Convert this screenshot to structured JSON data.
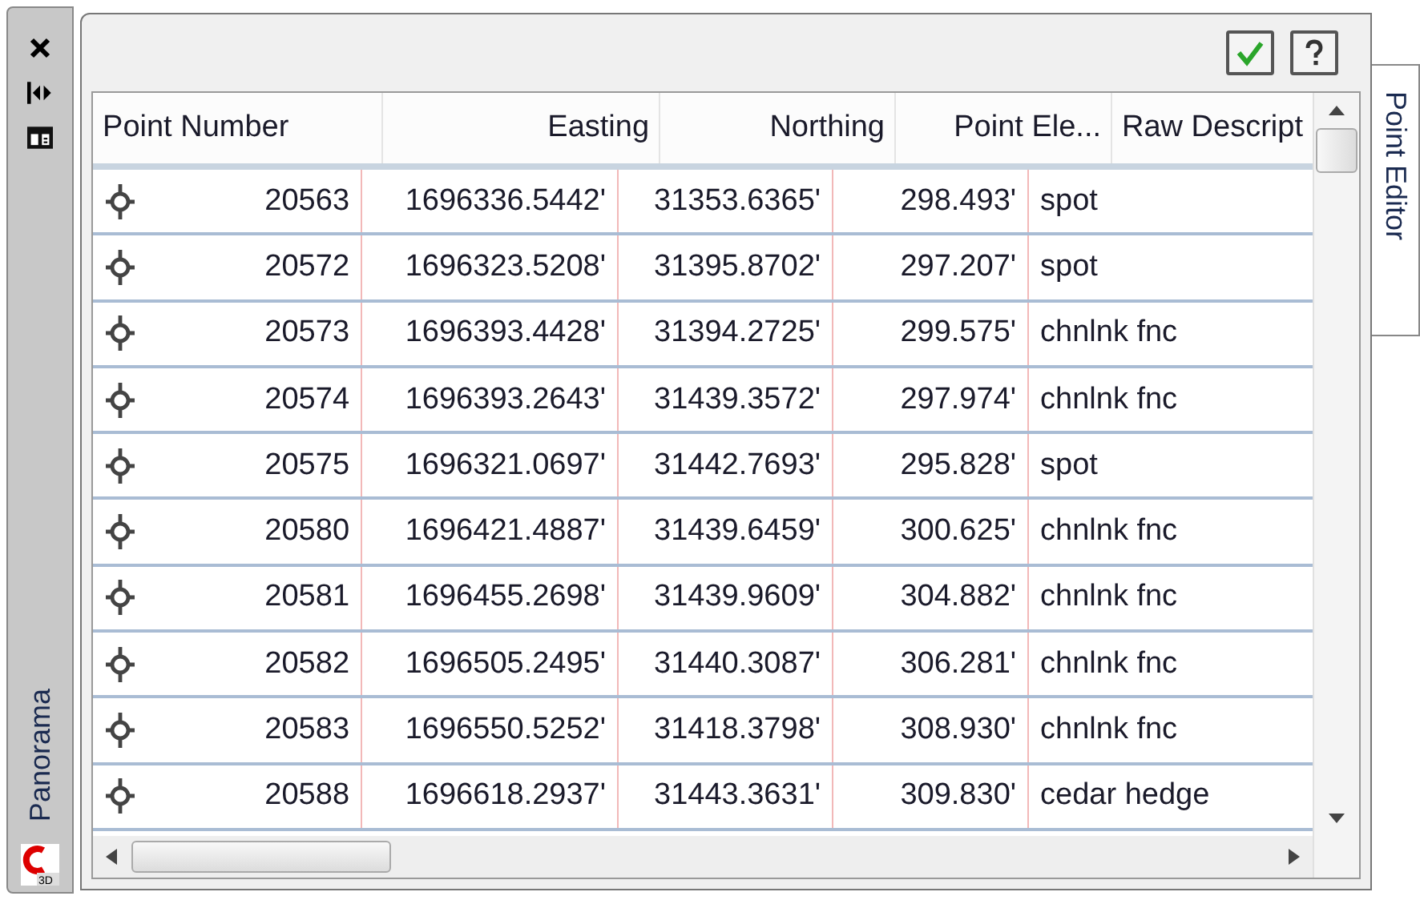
{
  "left_tab": "Panorama",
  "right_tab": "Point Editor",
  "logo_text": "3D",
  "table": {
    "columns": [
      "Point Number",
      "Easting",
      "Northing",
      "Point Ele...",
      "Raw Descript"
    ],
    "rows": [
      [
        "20563",
        "1696336.5442'",
        "31353.6365'",
        "298.493'",
        "spot"
      ],
      [
        "20572",
        "1696323.5208'",
        "31395.8702'",
        "297.207'",
        "spot"
      ],
      [
        "20573",
        "1696393.4428'",
        "31394.2725'",
        "299.575'",
        "chnlnk fnc"
      ],
      [
        "20574",
        "1696393.2643'",
        "31439.3572'",
        "297.974'",
        "chnlnk fnc"
      ],
      [
        "20575",
        "1696321.0697'",
        "31442.7693'",
        "295.828'",
        "spot"
      ],
      [
        "20580",
        "1696421.4887'",
        "31439.6459'",
        "300.625'",
        "chnlnk fnc"
      ],
      [
        "20581",
        "1696455.2698'",
        "31439.9609'",
        "304.882'",
        "chnlnk fnc"
      ],
      [
        "20582",
        "1696505.2495'",
        "31440.3087'",
        "306.281'",
        "chnlnk fnc"
      ],
      [
        "20583",
        "1696550.5252'",
        "31418.3798'",
        "308.930'",
        "chnlnk fnc"
      ],
      [
        "20588",
        "1696618.2937'",
        "31443.3631'",
        "309.830'",
        "cedar hedge"
      ]
    ]
  }
}
